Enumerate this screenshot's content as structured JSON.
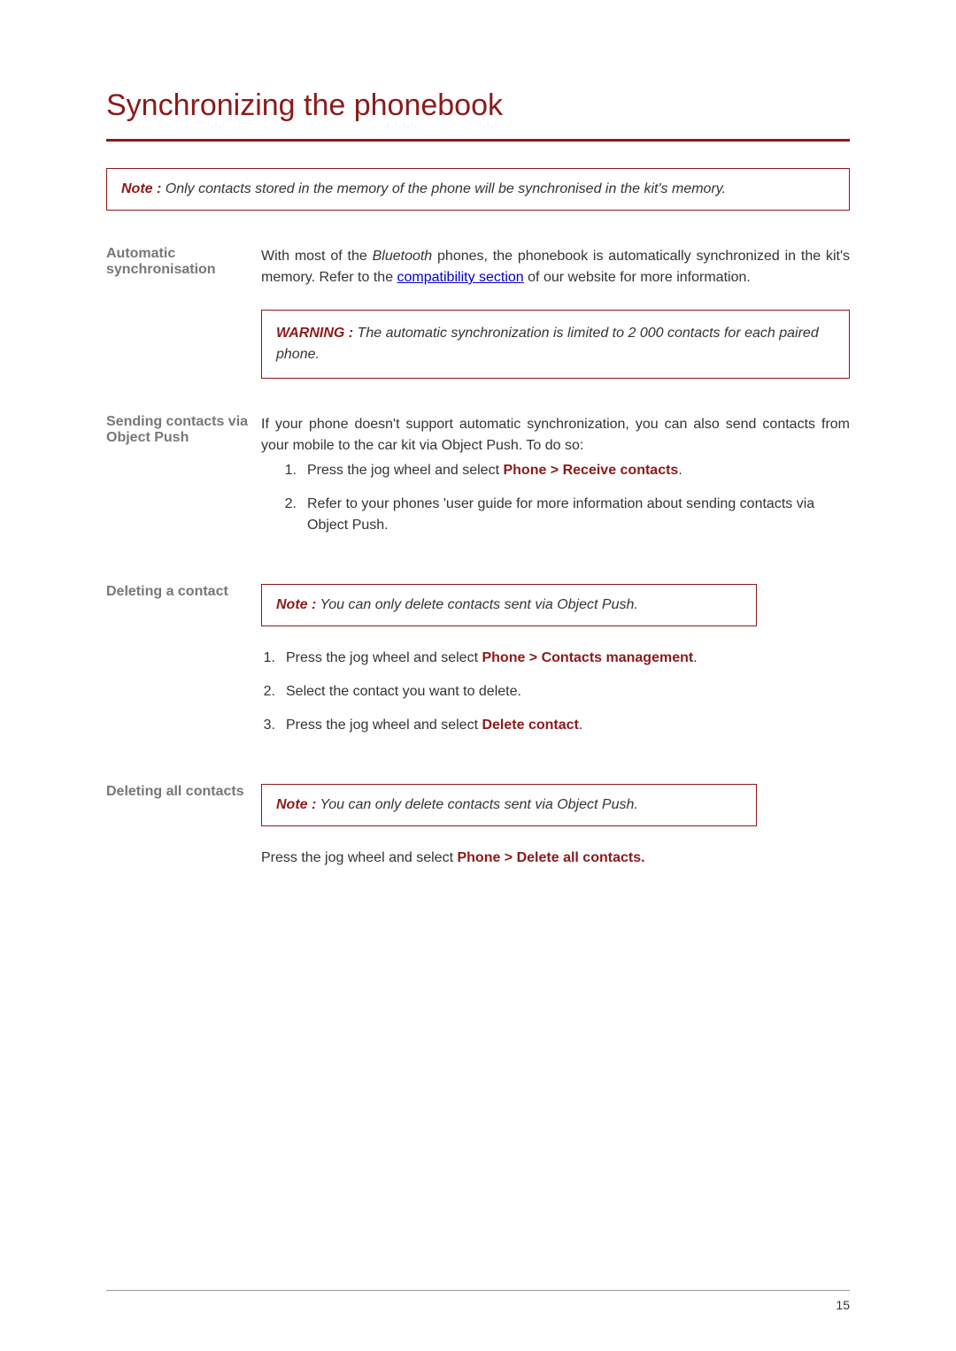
{
  "page": {
    "title": "Synchronizing the phonebook",
    "number": "15"
  },
  "top_note": {
    "label": "Note :",
    "text": " Only contacts stored in the memory of the phone will be synchronised in the kit's memory."
  },
  "sections": {
    "auto": {
      "heading": "Automatic synchronisation",
      "para_before": "With most of the ",
      "bluetooth": "Bluetooth",
      "para_mid": " phones, the phonebook is automatically synchronized in the kit's memory. Refer to the ",
      "link": "compatibility section",
      "para_after": " of our website for more information.",
      "warning_label": "WARNING :",
      "warning_text": "  The automatic synchronization is limited to 2 000 contacts for each paired phone."
    },
    "push": {
      "heading": "Sending contacts via Object Push",
      "intro": "If your phone doesn't support automatic synchronization, you can also send contacts from your mobile to the car kit via Object Push. To do so:",
      "items": [
        {
          "num": "1.",
          "pre": "Press the jog wheel and select ",
          "accent": "Phone > Receive contacts",
          "post": "."
        },
        {
          "num": "2.",
          "pre": "Refer to your phones 'user guide for more information about sending contacts via Object Push.",
          "accent": "",
          "post": ""
        }
      ]
    },
    "delete_one": {
      "heading": "Deleting a contact",
      "note_label": "Note :",
      "note_text": " You can only delete contacts sent via Object Push.",
      "items": [
        {
          "num": "1.",
          "pre": "Press the jog wheel and select ",
          "accent": "Phone > Contacts management",
          "post": "."
        },
        {
          "num": "2.",
          "pre": "Select the contact you want to delete.",
          "accent": "",
          "post": ""
        },
        {
          "num": "3.",
          "pre": "Press the jog wheel and select ",
          "accent": "Delete contact",
          "post": "."
        }
      ]
    },
    "delete_all": {
      "heading": "Deleting all contacts",
      "note_label": "Note :",
      "note_text": "  You can only delete contacts sent via Object Push.",
      "instr_pre": "Press the jog wheel and select ",
      "instr_accent": "Phone > Delete all contacts.",
      "instr_post": ""
    }
  }
}
